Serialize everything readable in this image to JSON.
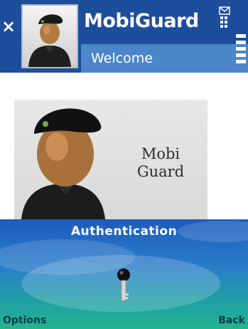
{
  "titlebar": {
    "app_title": "MobiGuard",
    "subtitle": "Welcome",
    "icons": [
      "close-icon",
      "user-avatar-icon",
      "message-status-icon",
      "signal-strength-icon"
    ]
  },
  "splash": {
    "brand_line1": "Mobi",
    "brand_line2": "Guard"
  },
  "auth": {
    "header": "Authentication",
    "icon": "key-icon"
  },
  "softkeys": {
    "left": "Options",
    "right": "Back"
  },
  "colors": {
    "titlebar": "#1d4e9c",
    "subtitle_band": "#4a86c8",
    "panel_top": "#1e5bbf",
    "panel_bottom": "#22b48f"
  }
}
